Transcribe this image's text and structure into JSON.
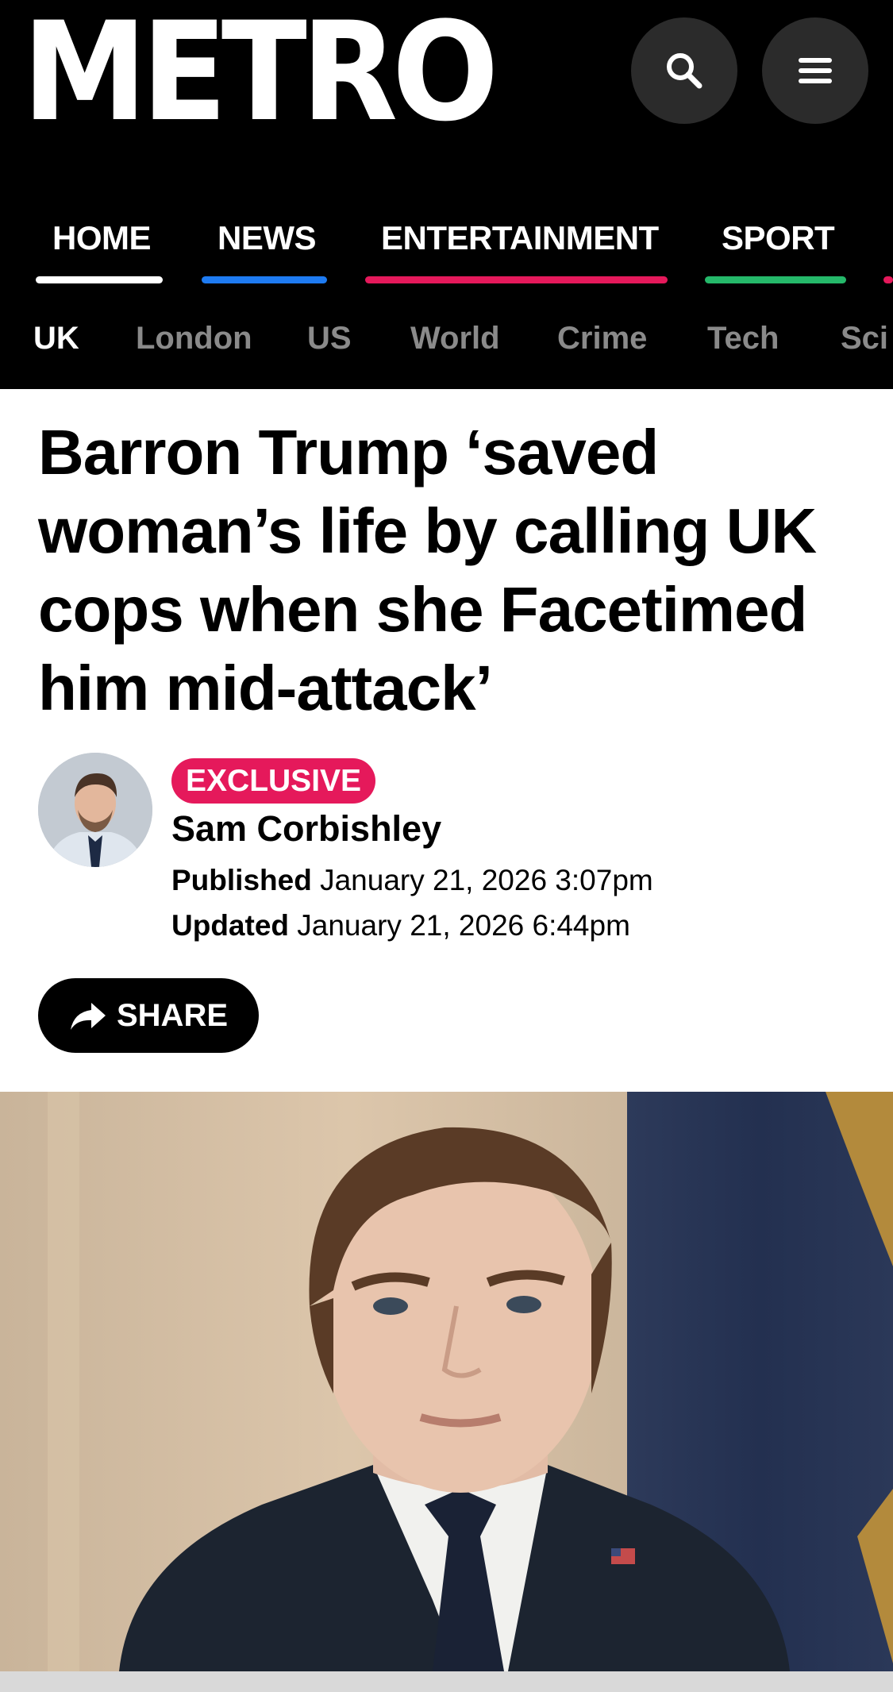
{
  "header": {
    "logo": "METRO",
    "search_icon": "search-icon",
    "menu_icon": "hamburger-menu-icon"
  },
  "nav": {
    "items": [
      {
        "label": "HOME",
        "color": "#ffffff"
      },
      {
        "label": "NEWS",
        "color": "#1e7bf2"
      },
      {
        "label": "ENTERTAINMENT",
        "color": "#e5195b"
      },
      {
        "label": "SPORT",
        "color": "#25b86a"
      }
    ],
    "next_item_color": "#e5195b"
  },
  "subnav": {
    "items": [
      "UK",
      "London",
      "US",
      "World",
      "Crime",
      "Tech",
      "Sci"
    ],
    "active": "UK"
  },
  "article": {
    "headline_lines": [
      "Barron Trump ‘saved",
      "woman’s life by calling UK",
      "cops when she Facetimed",
      "him mid-attack’"
    ],
    "badge": "EXCLUSIVE",
    "badge_color": "#e5195b",
    "author": "Sam Corbishley",
    "published_label": "Published",
    "published_value": "January 21, 2026 3:07pm",
    "updated_label": "Updated",
    "updated_value": "January 21, 2026 6:44pm",
    "share_label": "SHARE",
    "share_icon": "share-arrow-icon"
  }
}
